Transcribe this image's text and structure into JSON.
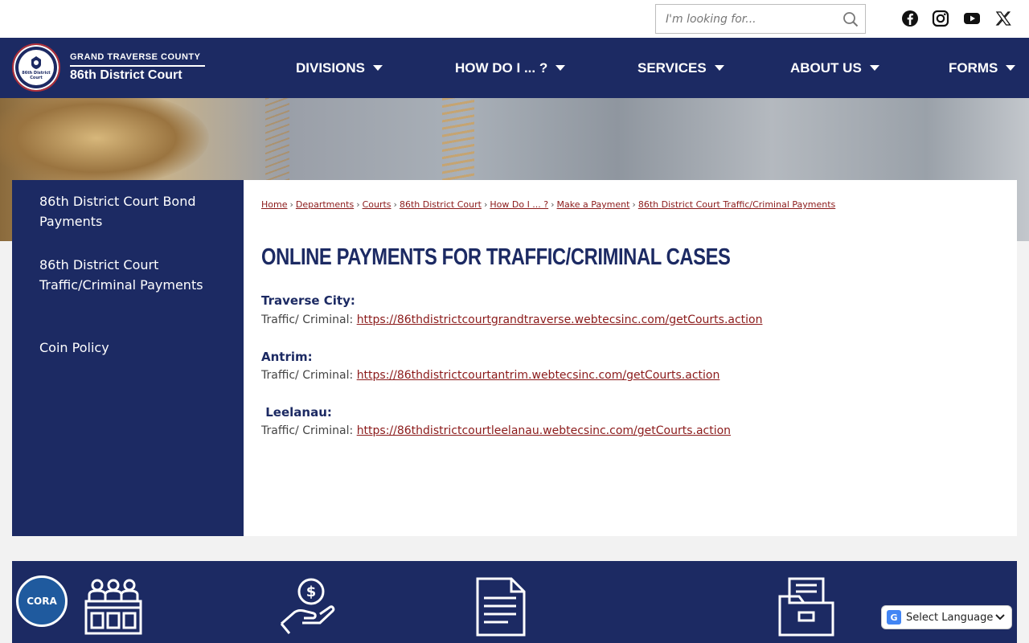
{
  "search": {
    "placeholder": "I'm looking for..."
  },
  "social": [
    "facebook-icon",
    "instagram-icon",
    "youtube-icon",
    "x-icon"
  ],
  "brand": {
    "county": "GRAND TRAVERSE COUNTY",
    "court": "86th District Court",
    "seal_line1": "86th District",
    "seal_line2": "Court"
  },
  "nav": [
    {
      "label": "DIVISIONS"
    },
    {
      "label": "HOW DO I ... ?"
    },
    {
      "label": "SERVICES"
    },
    {
      "label": "ABOUT US"
    },
    {
      "label": "FORMS"
    }
  ],
  "sidebar": {
    "items": [
      {
        "label": "86th District Court Bond Payments"
      },
      {
        "label": "86th District Court Traffic/Criminal Payments"
      },
      {
        "label": "Coin Policy"
      }
    ]
  },
  "breadcrumb": [
    "Home",
    "Departments",
    "Courts",
    "86th District Court",
    "How Do I ... ?",
    "Make a Payment",
    "86th District Court Traffic/Criminal Payments"
  ],
  "page": {
    "title": "ONLINE PAYMENTS FOR TRAFFIC/CRIMINAL CASES",
    "locations": [
      {
        "name": "Traverse City:",
        "prefix": "Traffic/ Criminal: ",
        "url": "https://86thdistrictcourtgrandtraverse.webtecsinc.com/getCourts.action"
      },
      {
        "name": "Antrim:",
        "prefix": "Traffic/ Criminal: ",
        "url": "https://86thdistrictcourtantrim.webtecsinc.com/getCourts.action"
      },
      {
        "name": " Leelanau:",
        "prefix": "Traffic/ Criminal: ",
        "url": "https://86thdistrictcourtleelanau.webtecsinc.com/getCourts.action"
      }
    ]
  },
  "widgets": {
    "cora_label": "CORA",
    "translate_label": "Select Language"
  },
  "colors": {
    "navy": "#1c2a63",
    "link": "#8b1a1a"
  }
}
